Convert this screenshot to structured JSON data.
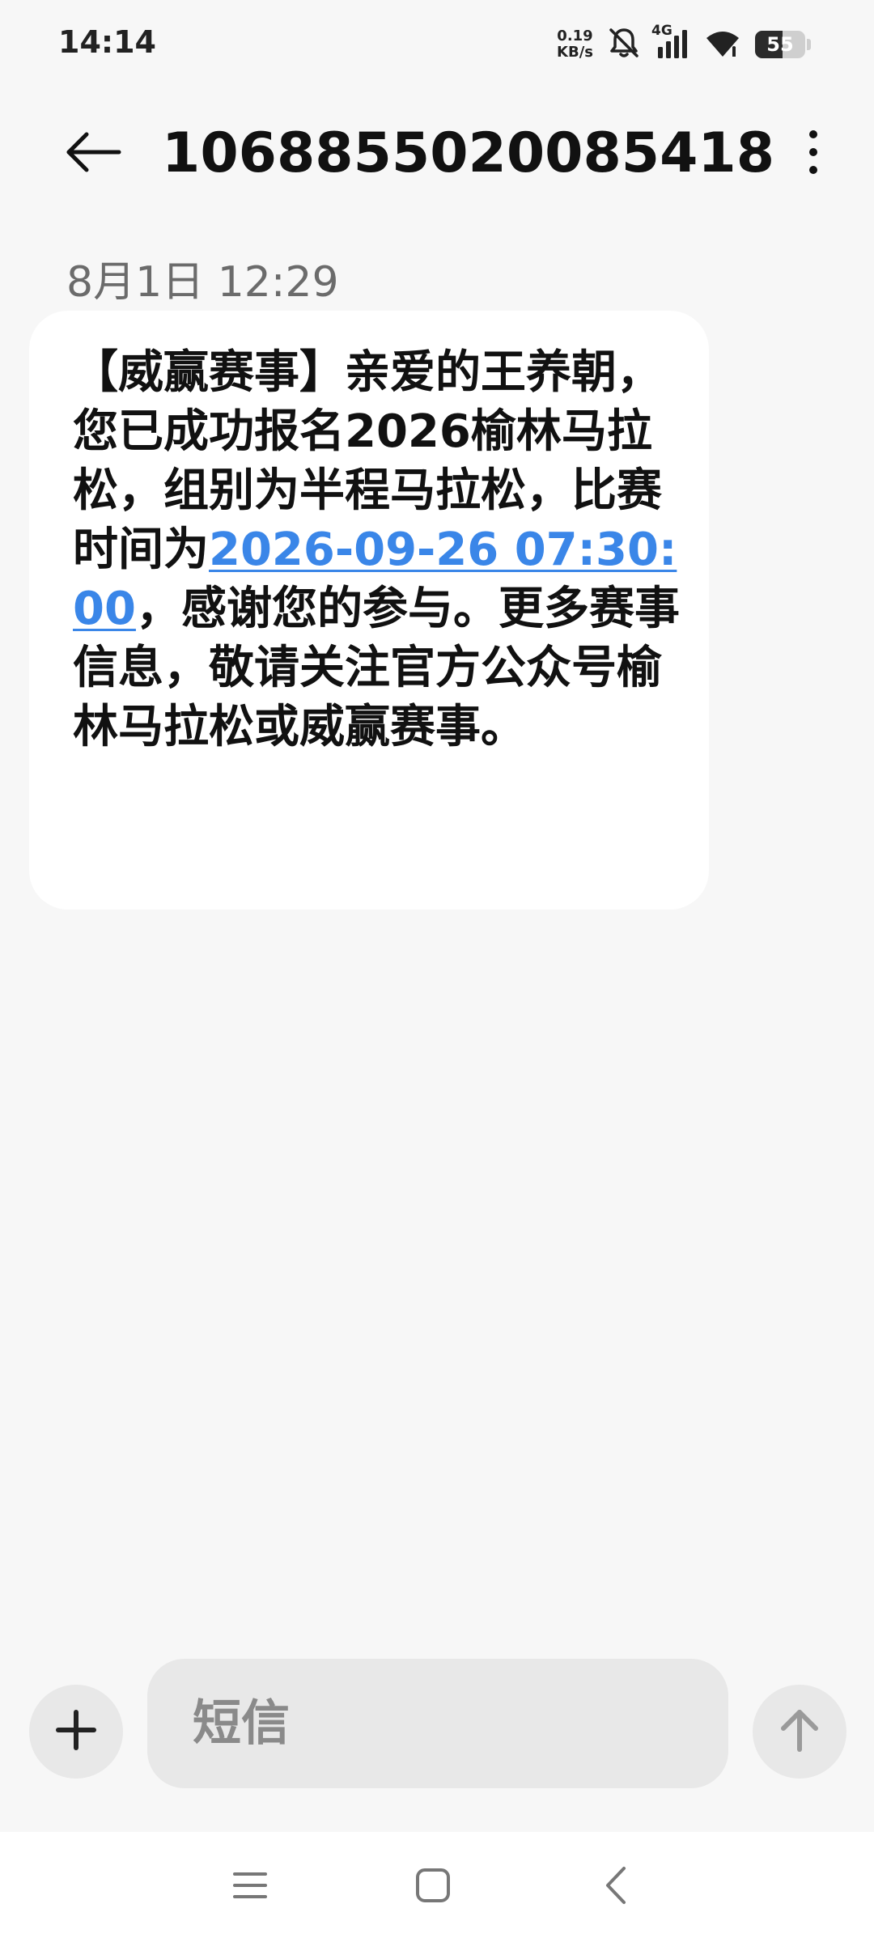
{
  "status_bar": {
    "time": "14:14",
    "net_speed_value": "0.19",
    "net_speed_unit": "KB/s",
    "network_type": "4G",
    "battery_level": "55",
    "battery_fraction": 0.55
  },
  "header": {
    "title": "1068855020085418"
  },
  "message": {
    "timestamp": "8月1日 12:29",
    "text_before_link": "【威赢赛事】亲爱的王养朝，您已成功报名2026榆林马拉松，组别为半程马拉松，比赛时间为",
    "link_text": "2026-09-26 07:30:00",
    "text_after_link": "，感谢您的参与。更多赛事信息，敬请关注官方公众号榆林马拉松或威赢赛事。"
  },
  "compose": {
    "placeholder": "短信"
  },
  "colors": {
    "background": "#f7f7f7",
    "bubble": "#ffffff",
    "link": "#3a86e8",
    "control_bg": "#e8e8e8"
  },
  "icons": {
    "back": "arrow-left-icon",
    "more": "more-vertical-icon",
    "plus": "plus-icon",
    "send": "arrow-up-icon",
    "nav_menu": "menu-icon",
    "nav_home": "square-icon",
    "nav_back": "chevron-left-icon"
  }
}
